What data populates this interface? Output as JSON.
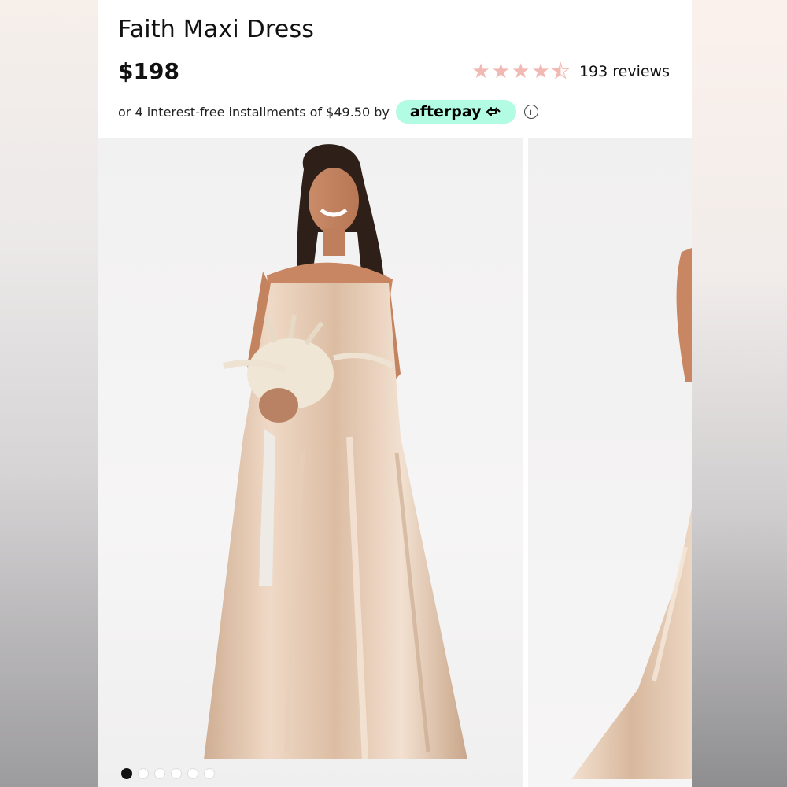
{
  "product": {
    "title": "Faith Maxi Dress",
    "price": "$198",
    "rating": 4.5,
    "rating_max": 5,
    "reviews_label": "193 reviews"
  },
  "installments": {
    "text": "or 4 interest-free installments of $49.50 by",
    "provider": "afterpay",
    "info_symbol": "i"
  },
  "gallery": {
    "image_count": 6,
    "active_index": 0
  },
  "colors": {
    "afterpay_bg": "#b2fce4",
    "star": "#f2b8b3",
    "dress": "#e9cdb4"
  }
}
